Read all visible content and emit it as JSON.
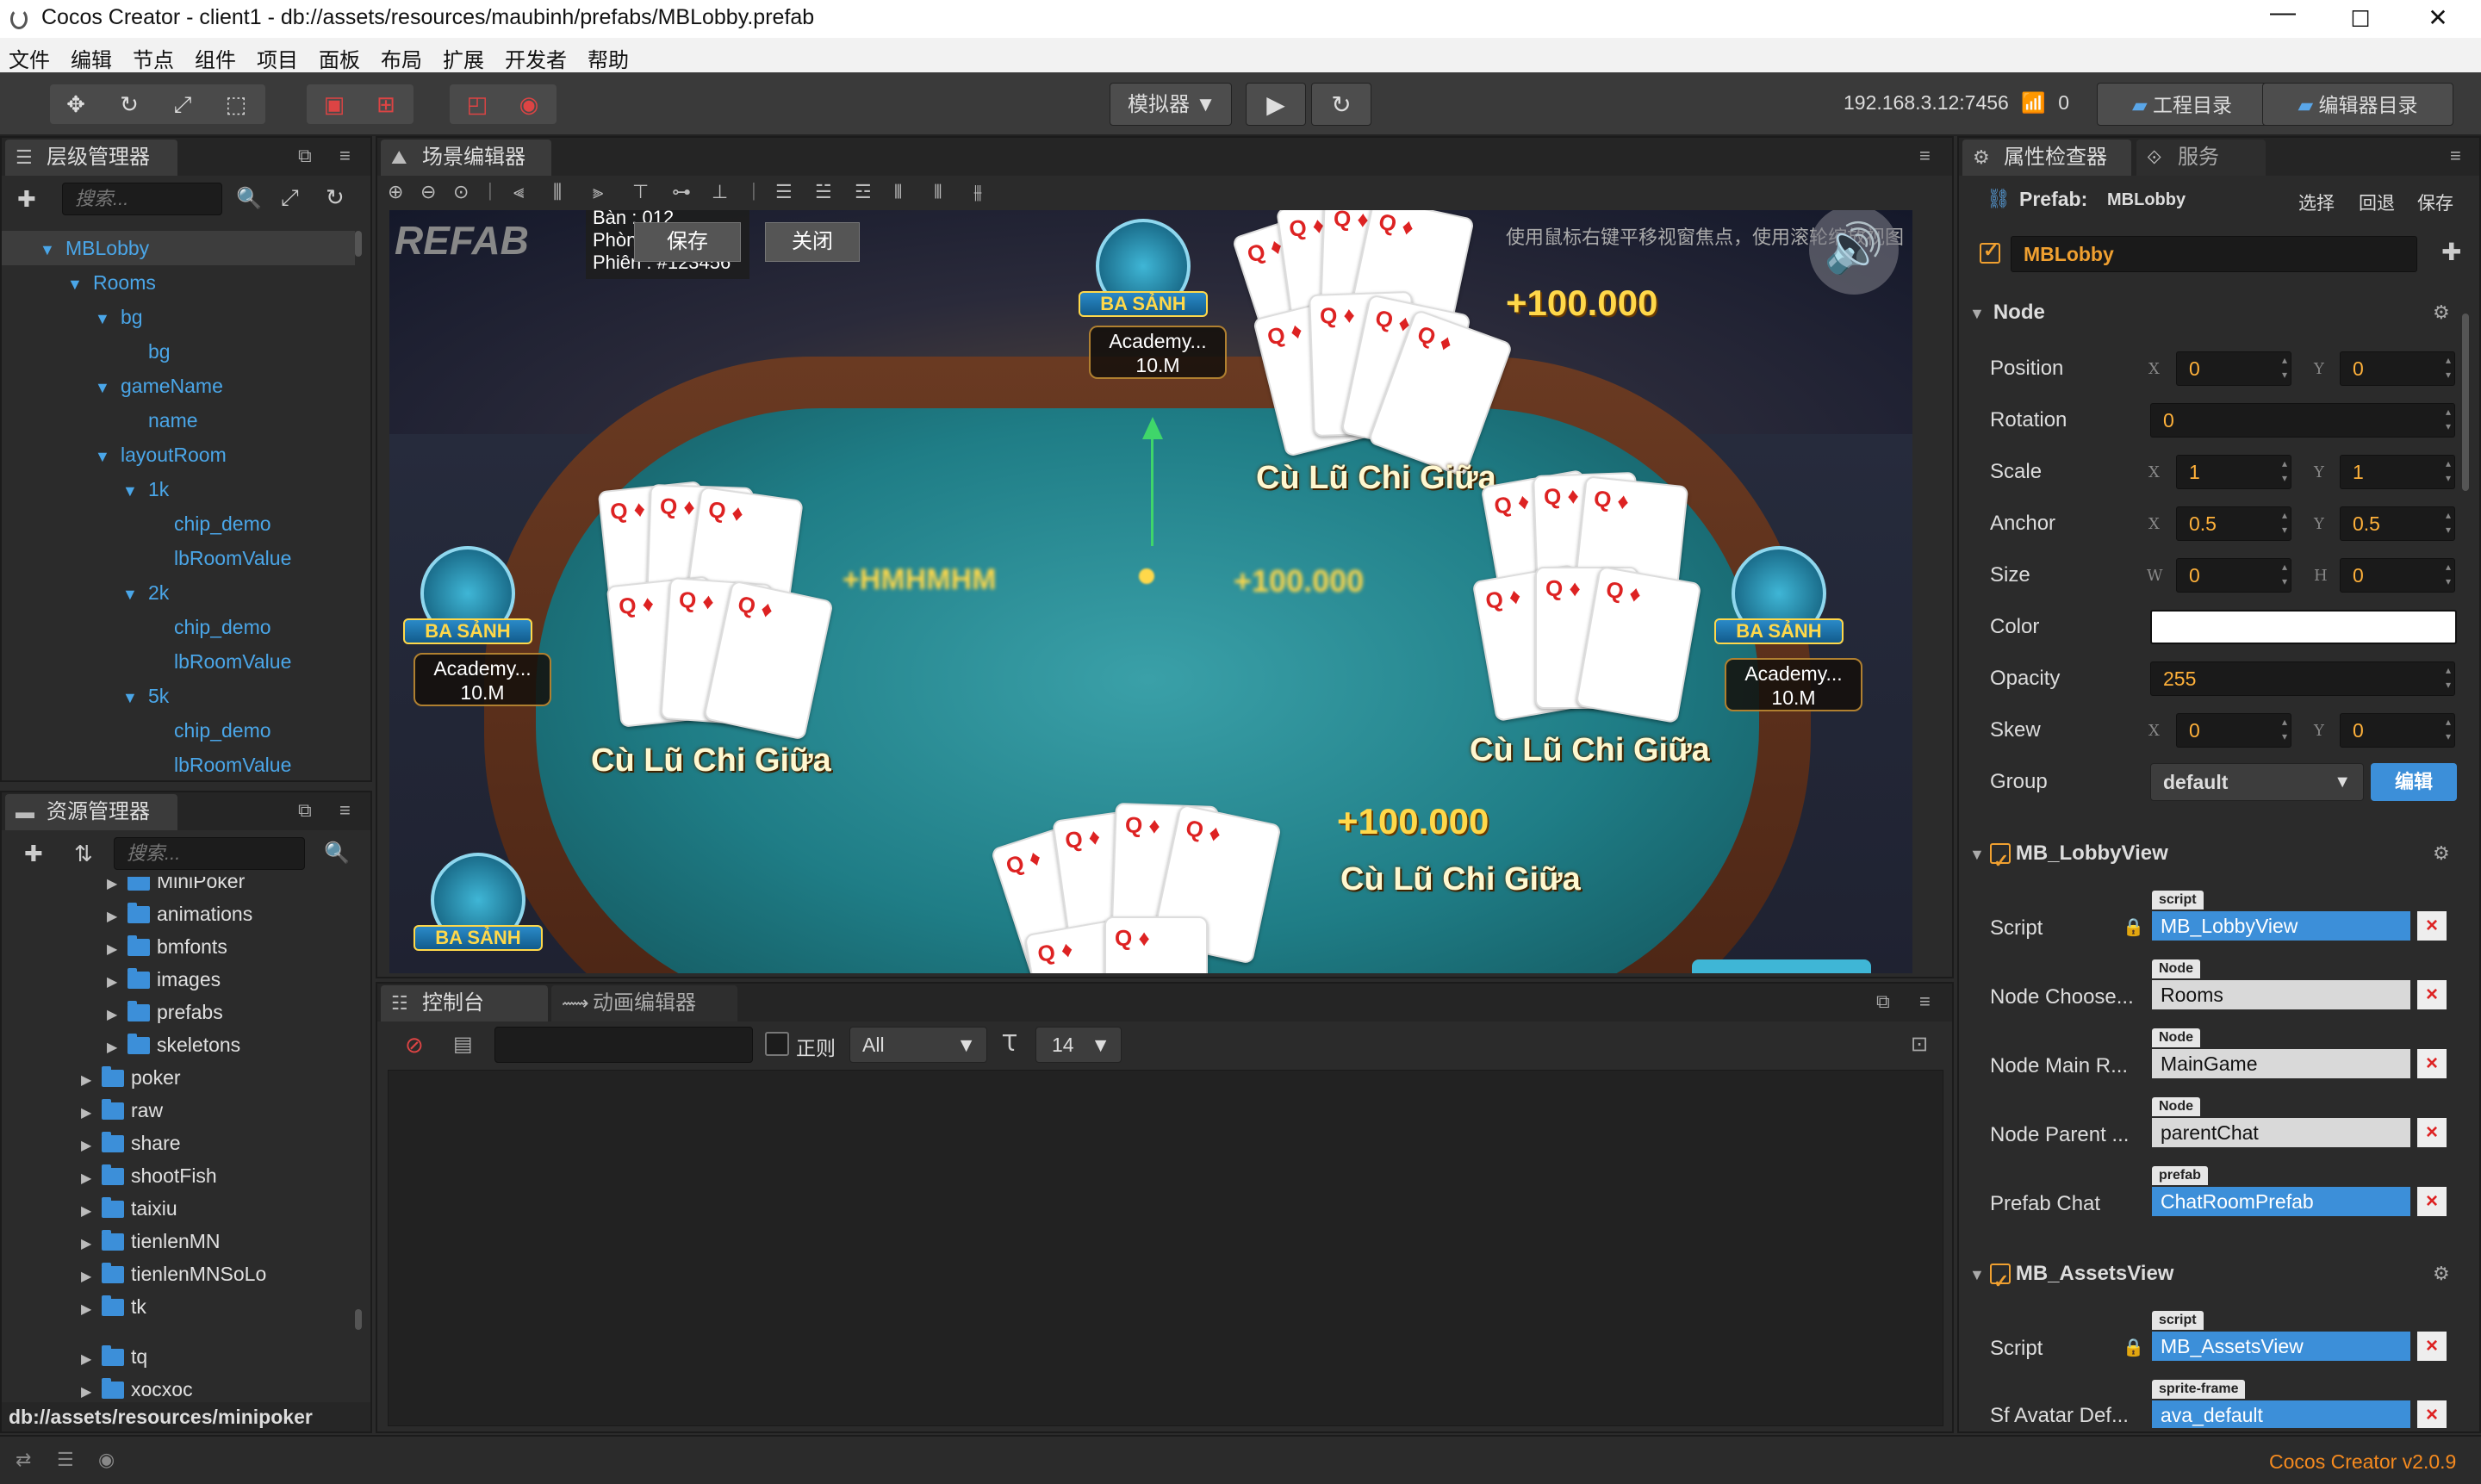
{
  "window": {
    "title": "Cocos Creator - client1 - db://assets/resources/maubinh/prefabs/MBLobby.prefab",
    "min_glyph": "—",
    "max_glyph": "☐",
    "close_glyph": "✕"
  },
  "menu": [
    "文件",
    "编辑",
    "节点",
    "组件",
    "项目",
    "面板",
    "布局",
    "扩展",
    "开发者",
    "帮助"
  ],
  "toolbar": {
    "simulator_label": "模拟器 ▼",
    "ip_text": "192.168.3.12:7456",
    "device_count": "0",
    "project_dir_label": "工程目录",
    "editor_dir_label": "编辑器目录"
  },
  "hierarchy": {
    "tab_label": "层级管理器",
    "search_placeholder": "搜索...",
    "nodes": [
      {
        "label": "MBLobby",
        "arrow": "▼"
      },
      {
        "label": "Rooms",
        "arrow": "▼"
      },
      {
        "label": "bg",
        "arrow": "▼"
      },
      {
        "label": "bg",
        "arrow": ""
      },
      {
        "label": "gameName",
        "arrow": "▼"
      },
      {
        "label": "name",
        "arrow": ""
      },
      {
        "label": "layoutRoom",
        "arrow": "▼"
      },
      {
        "label": "1k",
        "arrow": "▼"
      },
      {
        "label": "chip_demo",
        "arrow": ""
      },
      {
        "label": "lbRoomValue",
        "arrow": ""
      },
      {
        "label": "2k",
        "arrow": "▼"
      },
      {
        "label": "chip_demo",
        "arrow": ""
      },
      {
        "label": "lbRoomValue",
        "arrow": ""
      },
      {
        "label": "5k",
        "arrow": "▼"
      },
      {
        "label": "chip_demo",
        "arrow": ""
      },
      {
        "label": "lbRoomValue",
        "arrow": ""
      }
    ]
  },
  "assets": {
    "tab_label": "资源管理器",
    "search_placeholder": "搜索...",
    "items": [
      {
        "label": "MiniPoker"
      },
      {
        "label": "animations"
      },
      {
        "label": "bmfonts"
      },
      {
        "label": "images"
      },
      {
        "label": "prefabs"
      },
      {
        "label": "skeletons"
      },
      {
        "label": "poker"
      },
      {
        "label": "raw"
      },
      {
        "label": "share"
      },
      {
        "label": "shootFish"
      },
      {
        "label": "taixiu"
      },
      {
        "label": "tienlenMN"
      },
      {
        "label": "tienlenMNSoLo"
      },
      {
        "label": "tk"
      },
      {
        "label": "tq"
      },
      {
        "label": "xocxoc"
      }
    ],
    "footer_path": "db://assets/resources/minipoker"
  },
  "scene": {
    "tab_label": "场景编辑器",
    "hint": "使用鼠标右键平移视窗焦点，使用滚轮缩放视图",
    "save_label": "保存",
    "close_label": "关闭",
    "info_lines": [
      "Bàn    : 012",
      "Phòn",
      "Phiên  : #123456"
    ],
    "logo_text": "REFAB",
    "hand_label": "Cù Lũ Chi Giữa",
    "win_amount": "+100.000",
    "avatar_banner": "BA SẢNH",
    "player_name": "Academy...",
    "player_chips": "10.M",
    "blurred_left": "+HMHMHM",
    "blurred_right": "+100.000"
  },
  "console": {
    "tab_label": "控制台",
    "anim_tab_label": "动画编辑器",
    "regex_label": "正则",
    "filter_value": "All",
    "font_size": "14"
  },
  "inspector": {
    "tab_label": "属性检查器",
    "service_tab_label": "服务",
    "prefab_label": "Prefab:",
    "prefab_name": "MBLobby",
    "select_label": "选择",
    "revert_label": "回退",
    "save_label": "保存",
    "node_name": "MBLobby",
    "node_section": "Node",
    "props": {
      "position": {
        "label": "Position",
        "x": "0",
        "y": "0"
      },
      "rotation": {
        "label": "Rotation",
        "value": "0"
      },
      "scale": {
        "label": "Scale",
        "x": "1",
        "y": "1"
      },
      "anchor": {
        "label": "Anchor",
        "x": "0.5",
        "y": "0.5"
      },
      "size": {
        "label": "Size",
        "w": "0",
        "h": "0"
      },
      "color": {
        "label": "Color",
        "value": "#ffffff"
      },
      "opacity": {
        "label": "Opacity",
        "value": "255"
      },
      "skew": {
        "label": "Skew",
        "x": "0",
        "y": "0"
      },
      "group": {
        "label": "Group",
        "value": "default",
        "edit_label": "编辑"
      }
    },
    "lobby_view": {
      "title": "MB_LobbyView",
      "script": {
        "label": "Script",
        "type": "script",
        "value": "MB_LobbyView"
      },
      "node_choose": {
        "label": "Node Choose...",
        "type": "Node",
        "value": "Rooms"
      },
      "node_main": {
        "label": "Node Main R...",
        "type": "Node",
        "value": "MainGame"
      },
      "node_parent": {
        "label": "Node Parent ...",
        "type": "Node",
        "value": "parentChat"
      },
      "prefab_chat": {
        "label": "Prefab Chat",
        "type": "prefab",
        "value": "ChatRoomPrefab"
      }
    },
    "assets_view": {
      "title": "MB_AssetsView",
      "script": {
        "label": "Script",
        "type": "script",
        "value": "MB_AssetsView"
      },
      "sf_avatar": {
        "label": "Sf Avatar Def...",
        "type": "sprite-frame",
        "value": "ava_default"
      }
    }
  },
  "status": {
    "version": "Cocos Creator v2.0.9"
  },
  "colors": {
    "accent_blue": "#3c8fd9",
    "accent_orange": "#f0a030",
    "number_orange": "#ffb13a",
    "version_orange": "#f58a1f"
  }
}
